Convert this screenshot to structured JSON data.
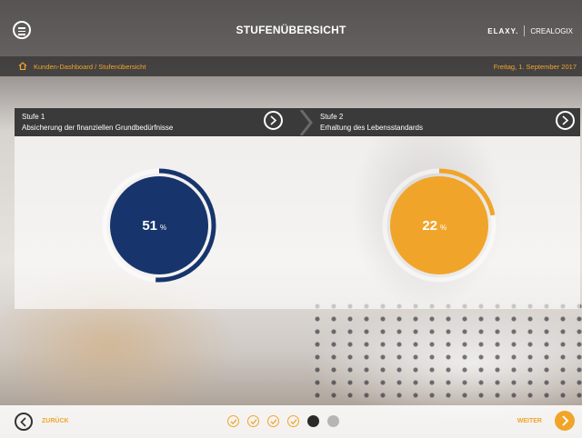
{
  "header": {
    "title": "STUFENÜBERSICHT",
    "brand_primary": "ELAXY.",
    "brand_secondary": "CREALOGIX"
  },
  "breadcrumb": {
    "path": "Kunden-Dashboard / Stufenübersicht",
    "date": "Freitag, 1. September 2017"
  },
  "stages": [
    {
      "label": "Stufe 1",
      "description": "Absicherung der finanziellen Grundbedürfnisse"
    },
    {
      "label": "Stufe 2",
      "description": "Erhaltung des Lebensstandards"
    }
  ],
  "gauges": [
    {
      "value": 51,
      "unit": "%",
      "color": "#17346c"
    },
    {
      "value": 22,
      "unit": "%",
      "color": "#f0a52a"
    }
  ],
  "footer": {
    "back_label": "ZURÜCK",
    "next_label": "WEITER",
    "steps": [
      "done",
      "done",
      "done",
      "done",
      "current",
      "todo"
    ]
  },
  "colors": {
    "accent": "#f0a52a",
    "dark": "#3a3a3a",
    "navy": "#17346c"
  }
}
